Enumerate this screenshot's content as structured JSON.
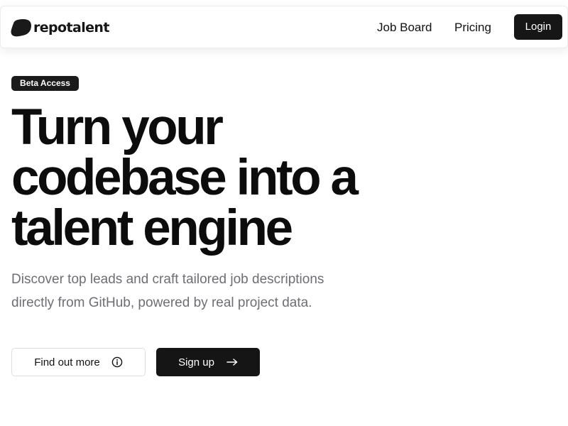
{
  "header": {
    "brand": "repotalent",
    "brand_icon": "blob-logo-icon",
    "nav": {
      "job_board": "Job Board",
      "pricing": "Pricing"
    },
    "login_label": "Login"
  },
  "hero": {
    "badge": "Beta Access",
    "title_lines": [
      "Turn your",
      "codebase into a",
      "talent engine"
    ],
    "subtitle": "Discover top leads and craft tailored job descriptions directly from GitHub, powered by real project data."
  },
  "actions": {
    "find_out_more": {
      "label": "Find out more",
      "icon": "info-icon"
    },
    "sign_up": {
      "label": "Sign up",
      "icon": "arrow-right-icon"
    }
  },
  "colors": {
    "primary_dark": "#161616",
    "background": "#ffffff",
    "muted_text": "#6e6e74",
    "border": "#dedede"
  }
}
